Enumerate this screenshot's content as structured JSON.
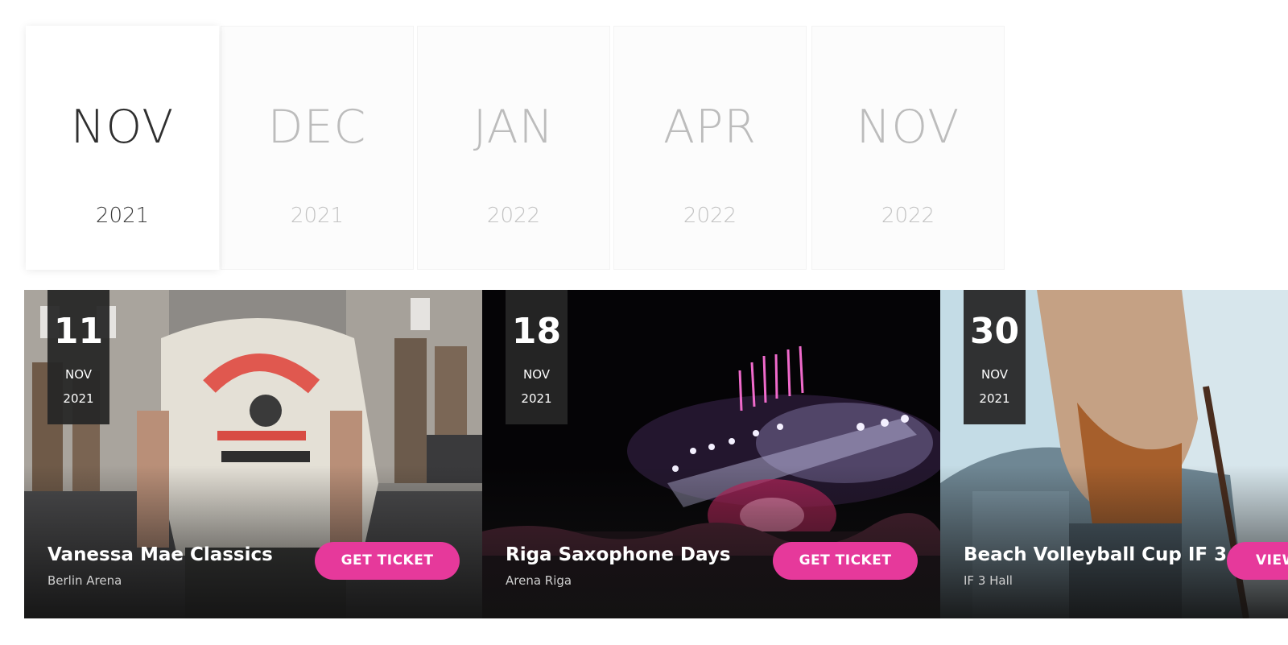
{
  "months": [
    {
      "month": "NOV",
      "year": "2021",
      "active": true
    },
    {
      "month": "DEC",
      "year": "2021",
      "active": false
    },
    {
      "month": "JAN",
      "year": "2022",
      "active": false
    },
    {
      "month": "APR",
      "year": "2022",
      "active": false
    },
    {
      "month": "NOV",
      "year": "2022",
      "active": false
    }
  ],
  "events": [
    {
      "day": "11",
      "month": "NOV",
      "year": "2021",
      "title": "Vanessa Mae Classics",
      "venue": "Berlin Arena",
      "button": "GET TICKET"
    },
    {
      "day": "18",
      "month": "NOV",
      "year": "2021",
      "title": "Riga Saxophone Days",
      "venue": "Arena Riga",
      "button": "GET TICKET"
    },
    {
      "day": "30",
      "month": "NOV",
      "year": "2021",
      "title": "Beach Volleyball Cup IF 3",
      "venue": "IF 3 Hall",
      "button": "VIEW"
    }
  ],
  "colors": {
    "accent": "#e6399b",
    "date_box": "#262626"
  }
}
